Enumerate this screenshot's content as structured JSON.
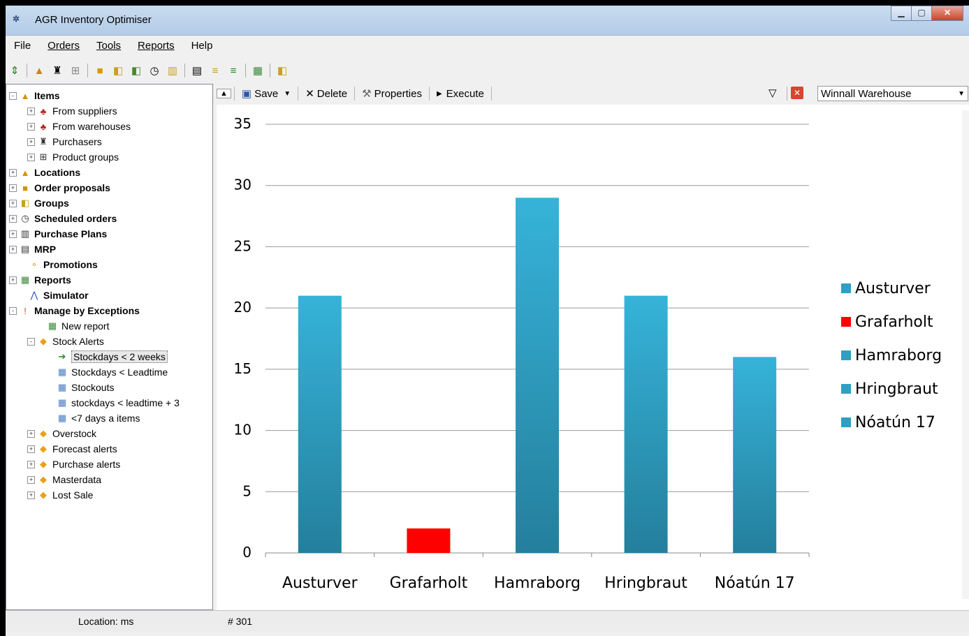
{
  "window": {
    "title": "AGR Inventory Optimiser",
    "icon": "app-logo-icon"
  },
  "menu": [
    "File",
    "Orders",
    "Tools",
    "Reports",
    "Help"
  ],
  "tree": {
    "items": [
      {
        "label": "Items",
        "bold": true,
        "icon": "boxes-icon"
      },
      {
        "label": "From suppliers",
        "icon": "suppliers-icon"
      },
      {
        "label": "From warehouses",
        "icon": "warehouses-icon"
      },
      {
        "label": "Purchasers",
        "icon": "purchaser-icon"
      },
      {
        "label": "Product groups",
        "icon": "product-groups-icon"
      },
      {
        "label": "Locations",
        "bold": true,
        "icon": "locations-icon"
      },
      {
        "label": "Order proposals",
        "bold": true,
        "icon": "truck-icon"
      },
      {
        "label": "Groups",
        "bold": true,
        "icon": "groups-icon"
      },
      {
        "label": "Scheduled orders",
        "bold": true,
        "icon": "clock-icon"
      },
      {
        "label": "Purchase Plans",
        "bold": true,
        "icon": "plan-icon"
      },
      {
        "label": "MRP",
        "bold": true,
        "icon": "mrp-icon"
      },
      {
        "label": "Promotions",
        "bold": true,
        "icon": "promotions-icon"
      },
      {
        "label": "Reports",
        "bold": true,
        "icon": "reports-icon"
      },
      {
        "label": "Simulator",
        "bold": true,
        "icon": "simulator-icon"
      },
      {
        "label": "Manage by Exceptions",
        "bold": true,
        "icon": "exclamation-icon"
      },
      {
        "label": "New report",
        "icon": "new-report-icon"
      },
      {
        "label": "Stock Alerts",
        "icon": "alert-icon"
      },
      {
        "label": "Stockdays < 2 weeks",
        "icon": "arrow-icon",
        "selected": true
      },
      {
        "label": "Stockdays < Leadtime",
        "icon": "grid-alert-icon"
      },
      {
        "label": "Stockouts",
        "icon": "grid-icon"
      },
      {
        "label": "stockdays < leadtime + 3",
        "icon": "grid-alert-icon"
      },
      {
        "label": "<7 days a items",
        "icon": "grid-alert-icon"
      },
      {
        "label": "Overstock",
        "icon": "alert-icon"
      },
      {
        "label": "Forecast alerts",
        "icon": "alert-icon"
      },
      {
        "label": "Purchase alerts",
        "icon": "alert-icon"
      },
      {
        "label": "Masterdata",
        "icon": "alert-icon"
      },
      {
        "label": "Lost Sale",
        "icon": "alert-icon"
      }
    ]
  },
  "rtoolbar": {
    "save": "Save",
    "delete": "Delete",
    "properties": "Properties",
    "execute": "Execute",
    "warehouse": "Winnall Warehouse"
  },
  "status": {
    "location": "Location: ms",
    "count": "# 301"
  },
  "colors": {
    "bar": "#2f9fc4",
    "highlight": "#ff0000"
  },
  "chart_data": {
    "type": "bar",
    "categories": [
      "Austurver",
      "Grafarholt",
      "Hamraborg",
      "Hringbraut",
      "Nóatún 17"
    ],
    "values": [
      21,
      2,
      29,
      21,
      16
    ],
    "colors": [
      "#2f9fc4",
      "#ff0000",
      "#2f9fc4",
      "#2f9fc4",
      "#2f9fc4"
    ],
    "legend": [
      "Austurver",
      "Grafarholt",
      "Hamraborg",
      "Hringbraut",
      "Nóatún 17"
    ],
    "ylim": [
      0,
      35
    ],
    "yticks": [
      0,
      5,
      10,
      15,
      20,
      25,
      30,
      35
    ],
    "grid": true,
    "legend_position": "right"
  }
}
